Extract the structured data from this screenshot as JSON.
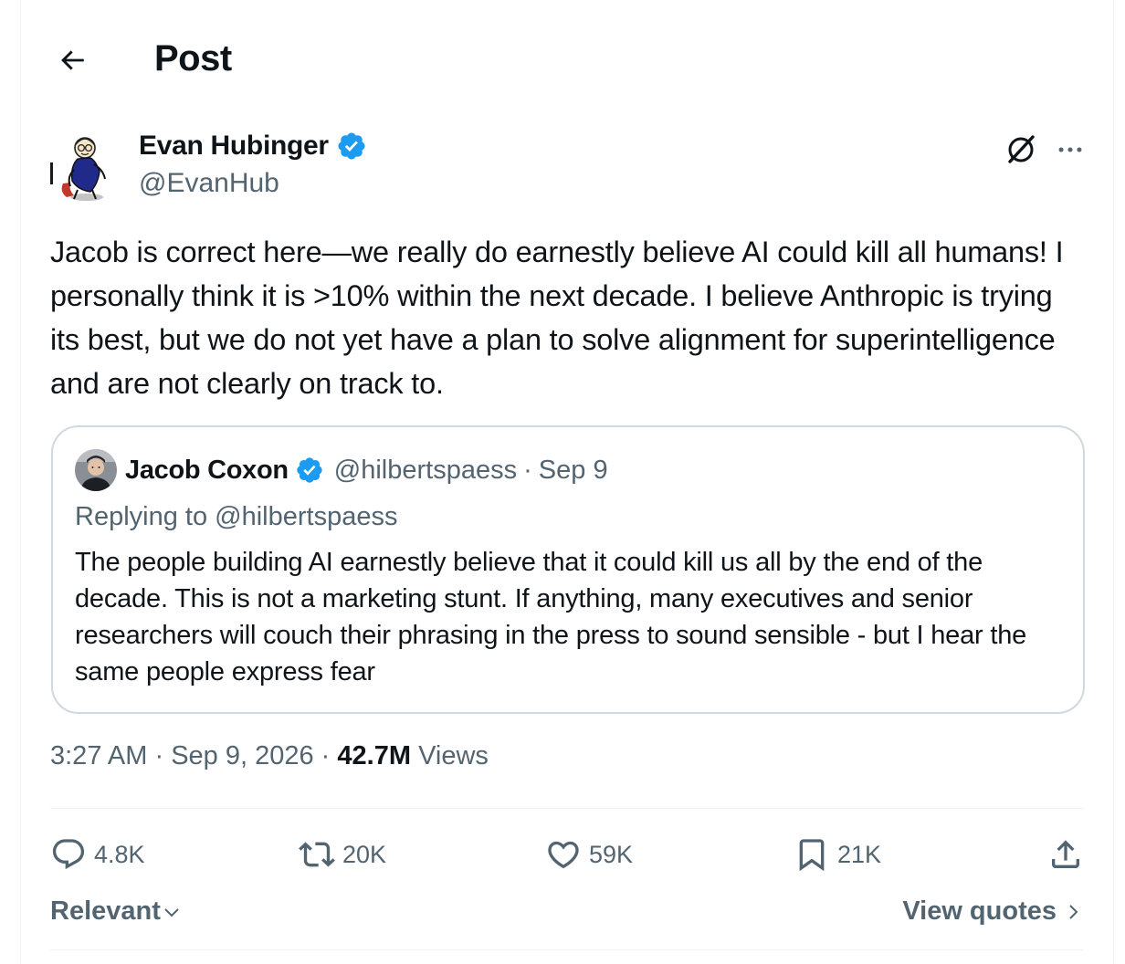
{
  "header": {
    "title": "Post",
    "back_icon": "arrow-left-icon"
  },
  "post": {
    "author_name": "Evan Hubinger",
    "author_handle": "@EvanHub",
    "verified": true,
    "text": "Jacob is correct here—we really do earnestly believe AI could kill all humans! I personally think it is >10% within the next decade. I believe Anthropic is trying its best, but we do not yet have a plan to solve alignment for superintelligence and are not clearly on track to.",
    "time": "3:27 AM",
    "date": "Sep 9, 2026",
    "views_count": "42.7M",
    "views_label": "Views"
  },
  "quote": {
    "author_name": "Jacob Coxon",
    "author_handle": "@hilbertspaess",
    "date": "Sep 9",
    "replying_label": "Replying to",
    "replying_to": "@hilbertspaess",
    "text": "The people building AI earnestly believe that it could kill us all by the end of the decade. This is not a marketing stunt. If anything, many executives and senior researchers will couch their phrasing in the press to sound sensible - but I hear the same people express fear"
  },
  "actions": {
    "replies": "4.8K",
    "reposts": "20K",
    "likes": "59K",
    "bookmarks": "21K"
  },
  "footer": {
    "sort_label": "Relevant",
    "view_quotes_label": "View quotes"
  },
  "colors": {
    "text_primary": "#0f1419",
    "text_secondary": "#536471",
    "verified_blue": "#1d9bf0",
    "border": "#cfd9de",
    "divider": "#eff3f4"
  }
}
